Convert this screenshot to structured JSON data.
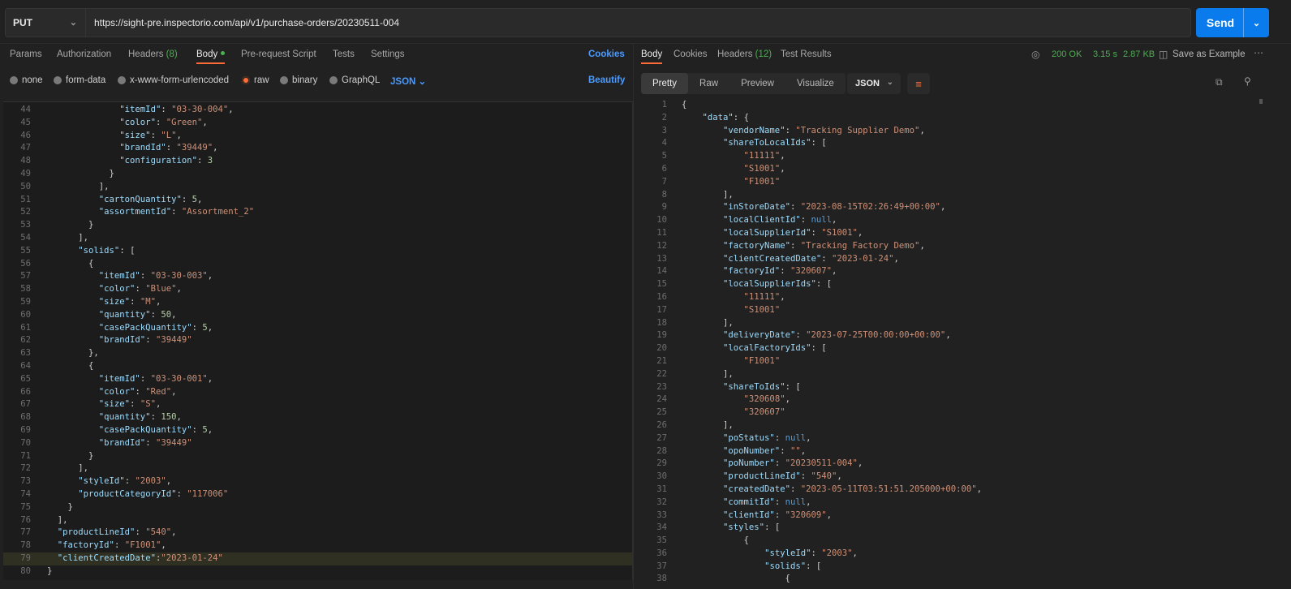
{
  "request": {
    "method": "PUT",
    "url": "https://sight-pre.inspectorio.com/api/v1/purchase-orders/20230511-004",
    "send_label": "Send"
  },
  "left_tabs": {
    "params": "Params",
    "authorization": "Authorization",
    "headers": "Headers",
    "headers_count": "(8)",
    "body": "Body",
    "pre_request": "Pre-request Script",
    "tests": "Tests",
    "settings": "Settings",
    "cookies": "Cookies"
  },
  "body_types": {
    "none": "none",
    "form_data": "form-data",
    "urlencoded": "x-www-form-urlencoded",
    "raw": "raw",
    "binary": "binary",
    "graphql": "GraphQL",
    "json": "JSON",
    "beautify": "Beautify"
  },
  "request_body": [
    {
      "n": "44",
      "t": "              \"itemId\": \"03-30-004\","
    },
    {
      "n": "45",
      "t": "              \"color\": \"Green\","
    },
    {
      "n": "46",
      "t": "              \"size\": \"L\","
    },
    {
      "n": "47",
      "t": "              \"brandId\": \"39449\","
    },
    {
      "n": "48",
      "t": "              \"configuration\": 3"
    },
    {
      "n": "49",
      "t": "            }"
    },
    {
      "n": "50",
      "t": "          ],"
    },
    {
      "n": "51",
      "t": "          \"cartonQuantity\": 5,"
    },
    {
      "n": "52",
      "t": "          \"assortmentId\": \"Assortment_2\""
    },
    {
      "n": "53",
      "t": "        }"
    },
    {
      "n": "54",
      "t": "      ],"
    },
    {
      "n": "55",
      "t": "      \"solids\": ["
    },
    {
      "n": "56",
      "t": "        {"
    },
    {
      "n": "57",
      "t": "          \"itemId\": \"03-30-003\","
    },
    {
      "n": "58",
      "t": "          \"color\": \"Blue\","
    },
    {
      "n": "59",
      "t": "          \"size\": \"M\","
    },
    {
      "n": "60",
      "t": "          \"quantity\": 50,"
    },
    {
      "n": "61",
      "t": "          \"casePackQuantity\": 5,"
    },
    {
      "n": "62",
      "t": "          \"brandId\": \"39449\""
    },
    {
      "n": "63",
      "t": "        },"
    },
    {
      "n": "64",
      "t": "        {"
    },
    {
      "n": "65",
      "t": "          \"itemId\": \"03-30-001\","
    },
    {
      "n": "66",
      "t": "          \"color\": \"Red\","
    },
    {
      "n": "67",
      "t": "          \"size\": \"S\","
    },
    {
      "n": "68",
      "t": "          \"quantity\": 150,"
    },
    {
      "n": "69",
      "t": "          \"casePackQuantity\": 5,"
    },
    {
      "n": "70",
      "t": "          \"brandId\": \"39449\""
    },
    {
      "n": "71",
      "t": "        }"
    },
    {
      "n": "72",
      "t": "      ],"
    },
    {
      "n": "73",
      "t": "      \"styleId\": \"2003\","
    },
    {
      "n": "74",
      "t": "      \"productCategoryId\": \"117006\""
    },
    {
      "n": "75",
      "t": "    }"
    },
    {
      "n": "76",
      "t": "  ],"
    },
    {
      "n": "77",
      "t": "  \"productLineId\": \"540\","
    },
    {
      "n": "78",
      "t": "  \"factoryId\": \"F1001\","
    },
    {
      "n": "79",
      "t": "  \"clientCreatedDate\":\"2023-01-24\""
    },
    {
      "n": "80",
      "t": "}"
    }
  ],
  "highlighted_line": "79",
  "response_tabs": {
    "body": "Body",
    "cookies": "Cookies",
    "headers": "Headers",
    "headers_count": "(12)",
    "test_results": "Test Results",
    "status": "200 OK",
    "time": "3.15 s",
    "size": "2.87 KB",
    "save_as_example": "Save as Example"
  },
  "view_modes": {
    "pretty": "Pretty",
    "raw": "Raw",
    "preview": "Preview",
    "visualize": "Visualize",
    "format": "JSON"
  },
  "response_body": [
    {
      "n": "1",
      "t": "{"
    },
    {
      "n": "2",
      "t": "    \"data\": {"
    },
    {
      "n": "3",
      "t": "        \"vendorName\": \"Tracking Supplier Demo\","
    },
    {
      "n": "4",
      "t": "        \"shareToLocalIds\": ["
    },
    {
      "n": "5",
      "t": "            \"11111\","
    },
    {
      "n": "6",
      "t": "            \"S1001\","
    },
    {
      "n": "7",
      "t": "            \"F1001\""
    },
    {
      "n": "8",
      "t": "        ],"
    },
    {
      "n": "9",
      "t": "        \"inStoreDate\": \"2023-08-15T02:26:49+00:00\","
    },
    {
      "n": "10",
      "t": "        \"localClientId\": null,"
    },
    {
      "n": "11",
      "t": "        \"localSupplierId\": \"S1001\","
    },
    {
      "n": "12",
      "t": "        \"factoryName\": \"Tracking Factory Demo\","
    },
    {
      "n": "13",
      "t": "        \"clientCreatedDate\": \"2023-01-24\","
    },
    {
      "n": "14",
      "t": "        \"factoryId\": \"320607\","
    },
    {
      "n": "15",
      "t": "        \"localSupplierIds\": ["
    },
    {
      "n": "16",
      "t": "            \"11111\","
    },
    {
      "n": "17",
      "t": "            \"S1001\""
    },
    {
      "n": "18",
      "t": "        ],"
    },
    {
      "n": "19",
      "t": "        \"deliveryDate\": \"2023-07-25T00:00:00+00:00\","
    },
    {
      "n": "20",
      "t": "        \"localFactoryIds\": ["
    },
    {
      "n": "21",
      "t": "            \"F1001\""
    },
    {
      "n": "22",
      "t": "        ],"
    },
    {
      "n": "23",
      "t": "        \"shareToIds\": ["
    },
    {
      "n": "24",
      "t": "            \"320608\","
    },
    {
      "n": "25",
      "t": "            \"320607\""
    },
    {
      "n": "26",
      "t": "        ],"
    },
    {
      "n": "27",
      "t": "        \"poStatus\": null,"
    },
    {
      "n": "28",
      "t": "        \"opoNumber\": \"\","
    },
    {
      "n": "29",
      "t": "        \"poNumber\": \"20230511-004\","
    },
    {
      "n": "30",
      "t": "        \"productLineId\": \"540\","
    },
    {
      "n": "31",
      "t": "        \"createdDate\": \"2023-05-11T03:51:51.205000+00:00\","
    },
    {
      "n": "32",
      "t": "        \"commitId\": null,"
    },
    {
      "n": "33",
      "t": "        \"clientId\": \"320609\","
    },
    {
      "n": "34",
      "t": "        \"styles\": ["
    },
    {
      "n": "35",
      "t": "            {"
    },
    {
      "n": "36",
      "t": "                \"styleId\": \"2003\","
    },
    {
      "n": "37",
      "t": "                \"solids\": ["
    },
    {
      "n": "38",
      "t": "                    {"
    }
  ],
  "colors": {
    "accent_orange": "#ff6c37",
    "send_blue": "#097bed",
    "status_green": "#4caf50",
    "link_blue": "#4b9bff"
  },
  "icons": [
    "chevron-down-icon",
    "globe-icon",
    "save-icon",
    "more-icon",
    "copy-icon",
    "search-icon",
    "wrap-lines-icon"
  ]
}
